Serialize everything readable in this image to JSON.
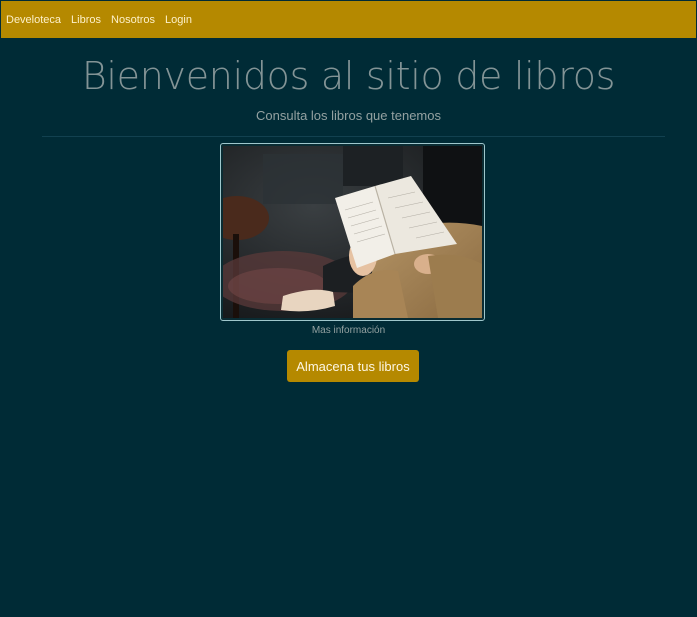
{
  "navbar": {
    "brand": "Develoteca",
    "links": [
      "Libros",
      "Nosotros",
      "Login"
    ]
  },
  "hero": {
    "title": "Bienvenidos al sitio de libros",
    "subtitle": "Consulta los libros que tenemos",
    "caption": "Mas información",
    "button_label": "Almacena tus libros",
    "image_subject": "person-reading-book"
  },
  "colors": {
    "page_background": "#002b36",
    "navbar_background": "#b58900",
    "button_background": "#b58900",
    "title_color": "#839496"
  }
}
